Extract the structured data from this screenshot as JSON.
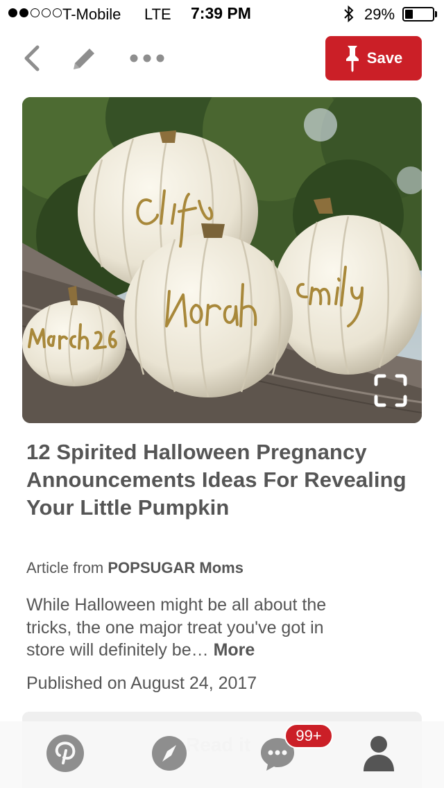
{
  "status_bar": {
    "signal_full": 2,
    "signal_total": 5,
    "carrier": "T-Mobile",
    "network": "LTE",
    "time": "7:39 PM",
    "battery_percent": "29%",
    "battery_level": 0.29,
    "bluetooth_icon": "bluetooth-icon"
  },
  "toolbar": {
    "back_icon": "chevron-left-icon",
    "edit_icon": "pencil-icon",
    "more_icon": "ellipsis-icon",
    "save_label": "Save",
    "save_icon": "pushpin-icon"
  },
  "pin": {
    "image_description_icon": "expand-icon",
    "pumpkin_names": [
      "Clif",
      "Norah",
      "emily",
      "March 26"
    ],
    "title": "12 Spirited Halloween Pregnancy Announcements Ideas For Revealing Your Little Pumpkin",
    "source_prefix": "Article from",
    "source_name": "POPSUGAR Moms",
    "description": "While Halloween might be all about the tricks, the one major treat you've got in store will definitely be…",
    "more_label": "More",
    "published": "Published on August 24, 2017"
  },
  "read_bar": {
    "label": "Read it"
  },
  "tab_bar": {
    "home_icon": "pinterest-logo-icon",
    "explore_icon": "compass-icon",
    "notifications_icon": "chat-bubble-icon",
    "notifications_badge": "99+",
    "profile_icon": "person-icon"
  },
  "colors": {
    "accent": "#cb1f27",
    "text": "#555555",
    "icon_gray": "#8e8e8e"
  }
}
